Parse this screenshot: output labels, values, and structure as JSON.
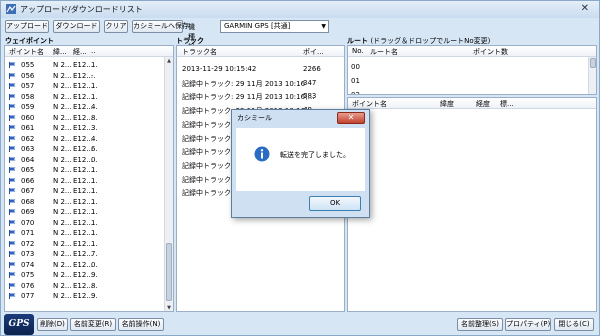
{
  "window": {
    "title": "アップロード/ダウンロードリスト",
    "close_glyph": "✕"
  },
  "toolbar": {
    "upload": "アップロード",
    "download": "ダウンロード",
    "clear": "クリア",
    "save_to_kashmir": "カシミールへ保存",
    "model_label": "機種設定",
    "model_value": "GARMIN GPS [共通]"
  },
  "waypoints": {
    "title": "ウェイポイント",
    "columns": [
      "ポイント名",
      "緯...",
      "経...",
      ".."
    ],
    "rows": [
      {
        "name": "055",
        "lat": "N 2...",
        "lon": "E12...",
        "x": "1."
      },
      {
        "name": "056",
        "lat": "N 2...",
        "lon": "E12...",
        "x": "-."
      },
      {
        "name": "057",
        "lat": "N 2...",
        "lon": "E12...",
        "x": "1."
      },
      {
        "name": "058",
        "lat": "N 2...",
        "lon": "E12...",
        "x": "1."
      },
      {
        "name": "059",
        "lat": "N 2...",
        "lon": "E12...",
        "x": "4."
      },
      {
        "name": "060",
        "lat": "N 2...",
        "lon": "E12...",
        "x": "8."
      },
      {
        "name": "061",
        "lat": "N 2...",
        "lon": "E12...",
        "x": "3."
      },
      {
        "name": "062",
        "lat": "N 2...",
        "lon": "E12...",
        "x": "4."
      },
      {
        "name": "063",
        "lat": "N 2...",
        "lon": "E12...",
        "x": "6."
      },
      {
        "name": "064",
        "lat": "N 2...",
        "lon": "E12...",
        "x": "0."
      },
      {
        "name": "065",
        "lat": "N 2...",
        "lon": "E12...",
        "x": "1."
      },
      {
        "name": "066",
        "lat": "N 2...",
        "lon": "E12...",
        "x": "1."
      },
      {
        "name": "067",
        "lat": "N 2...",
        "lon": "E12...",
        "x": "1."
      },
      {
        "name": "068",
        "lat": "N 2...",
        "lon": "E12...",
        "x": "1."
      },
      {
        "name": "069",
        "lat": "N 2...",
        "lon": "E12...",
        "x": "1."
      },
      {
        "name": "070",
        "lat": "N 2...",
        "lon": "E12...",
        "x": "1."
      },
      {
        "name": "071",
        "lat": "N 2...",
        "lon": "E12...",
        "x": "1."
      },
      {
        "name": "072",
        "lat": "N 2...",
        "lon": "E12...",
        "x": "1."
      },
      {
        "name": "073",
        "lat": "N 2...",
        "lon": "E12...",
        "x": "7."
      },
      {
        "name": "074",
        "lat": "N 2...",
        "lon": "E12...",
        "x": "0."
      },
      {
        "name": "075",
        "lat": "N 2...",
        "lon": "E12...",
        "x": "9."
      },
      {
        "name": "076",
        "lat": "N 2...",
        "lon": "E12...",
        "x": "8."
      },
      {
        "name": "077",
        "lat": "N 2...",
        "lon": "E12...",
        "x": "9."
      }
    ]
  },
  "tracks": {
    "title": "トラック",
    "columns": [
      "トラック名",
      "ポイ..."
    ],
    "rows": [
      {
        "name": "2013-11-29 10:15:42",
        "count": "2266"
      },
      {
        "name": "記録中トラック: 29 11月 2013 10:16",
        "count": "347"
      },
      {
        "name": "記録中トラック: 29 11月 2013 10:16(...",
        "count": "583"
      },
      {
        "name": "記録中トラック: 29 11月 2013 10:16(...",
        "count": "49"
      },
      {
        "name": "記録中トラック",
        "count": ""
      },
      {
        "name": "記録中トラック",
        "count": ""
      },
      {
        "name": "記録中トラック",
        "count": ""
      },
      {
        "name": "記録中トラック",
        "count": ""
      },
      {
        "name": "記録中トラック",
        "count": ""
      },
      {
        "name": "記録中トラック",
        "count": ""
      }
    ]
  },
  "routes": {
    "title": "ルート",
    "note": "(ドラッグ＆ドロップでルートNo変更)",
    "columns": [
      "No.",
      "ルート名",
      "ポイント数"
    ],
    "rows": [
      "00",
      "01",
      "02"
    ],
    "points_columns": [
      "ポイント名",
      "緯度",
      "経度",
      "標..."
    ]
  },
  "bottom": {
    "logo": "GPS",
    "delete": "削除(D)",
    "rename": "名前変更(R)",
    "name_ops": "名前操作(N)",
    "organize_names": "名前整理(S)",
    "properties": "プロパティ(P)",
    "close": "閉じる(C)"
  },
  "dialog": {
    "title": "カシミール",
    "close_glyph": "✕",
    "message": "転送を完了しました。",
    "ok": "OK"
  }
}
